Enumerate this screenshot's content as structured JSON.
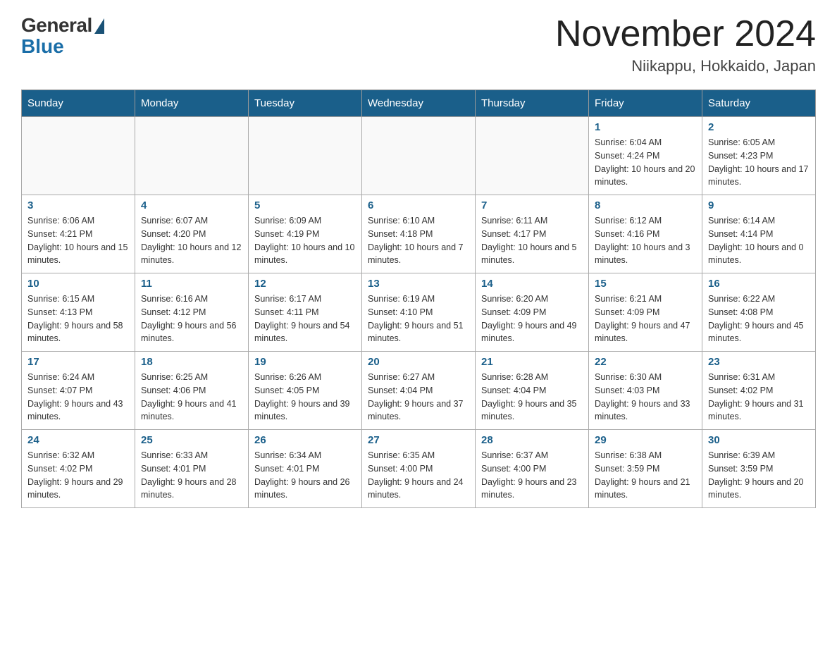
{
  "header": {
    "logo": {
      "general": "General",
      "blue": "Blue"
    },
    "title": "November 2024",
    "subtitle": "Niikappu, Hokkaido, Japan"
  },
  "weekdays": [
    "Sunday",
    "Monday",
    "Tuesday",
    "Wednesday",
    "Thursday",
    "Friday",
    "Saturday"
  ],
  "weeks": [
    [
      {
        "day": null
      },
      {
        "day": null
      },
      {
        "day": null
      },
      {
        "day": null
      },
      {
        "day": null
      },
      {
        "day": 1,
        "sunrise": "6:04 AM",
        "sunset": "4:24 PM",
        "daylight": "10 hours and 20 minutes."
      },
      {
        "day": 2,
        "sunrise": "6:05 AM",
        "sunset": "4:23 PM",
        "daylight": "10 hours and 17 minutes."
      }
    ],
    [
      {
        "day": 3,
        "sunrise": "6:06 AM",
        "sunset": "4:21 PM",
        "daylight": "10 hours and 15 minutes."
      },
      {
        "day": 4,
        "sunrise": "6:07 AM",
        "sunset": "4:20 PM",
        "daylight": "10 hours and 12 minutes."
      },
      {
        "day": 5,
        "sunrise": "6:09 AM",
        "sunset": "4:19 PM",
        "daylight": "10 hours and 10 minutes."
      },
      {
        "day": 6,
        "sunrise": "6:10 AM",
        "sunset": "4:18 PM",
        "daylight": "10 hours and 7 minutes."
      },
      {
        "day": 7,
        "sunrise": "6:11 AM",
        "sunset": "4:17 PM",
        "daylight": "10 hours and 5 minutes."
      },
      {
        "day": 8,
        "sunrise": "6:12 AM",
        "sunset": "4:16 PM",
        "daylight": "10 hours and 3 minutes."
      },
      {
        "day": 9,
        "sunrise": "6:14 AM",
        "sunset": "4:14 PM",
        "daylight": "10 hours and 0 minutes."
      }
    ],
    [
      {
        "day": 10,
        "sunrise": "6:15 AM",
        "sunset": "4:13 PM",
        "daylight": "9 hours and 58 minutes."
      },
      {
        "day": 11,
        "sunrise": "6:16 AM",
        "sunset": "4:12 PM",
        "daylight": "9 hours and 56 minutes."
      },
      {
        "day": 12,
        "sunrise": "6:17 AM",
        "sunset": "4:11 PM",
        "daylight": "9 hours and 54 minutes."
      },
      {
        "day": 13,
        "sunrise": "6:19 AM",
        "sunset": "4:10 PM",
        "daylight": "9 hours and 51 minutes."
      },
      {
        "day": 14,
        "sunrise": "6:20 AM",
        "sunset": "4:09 PM",
        "daylight": "9 hours and 49 minutes."
      },
      {
        "day": 15,
        "sunrise": "6:21 AM",
        "sunset": "4:09 PM",
        "daylight": "9 hours and 47 minutes."
      },
      {
        "day": 16,
        "sunrise": "6:22 AM",
        "sunset": "4:08 PM",
        "daylight": "9 hours and 45 minutes."
      }
    ],
    [
      {
        "day": 17,
        "sunrise": "6:24 AM",
        "sunset": "4:07 PM",
        "daylight": "9 hours and 43 minutes."
      },
      {
        "day": 18,
        "sunrise": "6:25 AM",
        "sunset": "4:06 PM",
        "daylight": "9 hours and 41 minutes."
      },
      {
        "day": 19,
        "sunrise": "6:26 AM",
        "sunset": "4:05 PM",
        "daylight": "9 hours and 39 minutes."
      },
      {
        "day": 20,
        "sunrise": "6:27 AM",
        "sunset": "4:04 PM",
        "daylight": "9 hours and 37 minutes."
      },
      {
        "day": 21,
        "sunrise": "6:28 AM",
        "sunset": "4:04 PM",
        "daylight": "9 hours and 35 minutes."
      },
      {
        "day": 22,
        "sunrise": "6:30 AM",
        "sunset": "4:03 PM",
        "daylight": "9 hours and 33 minutes."
      },
      {
        "day": 23,
        "sunrise": "6:31 AM",
        "sunset": "4:02 PM",
        "daylight": "9 hours and 31 minutes."
      }
    ],
    [
      {
        "day": 24,
        "sunrise": "6:32 AM",
        "sunset": "4:02 PM",
        "daylight": "9 hours and 29 minutes."
      },
      {
        "day": 25,
        "sunrise": "6:33 AM",
        "sunset": "4:01 PM",
        "daylight": "9 hours and 28 minutes."
      },
      {
        "day": 26,
        "sunrise": "6:34 AM",
        "sunset": "4:01 PM",
        "daylight": "9 hours and 26 minutes."
      },
      {
        "day": 27,
        "sunrise": "6:35 AM",
        "sunset": "4:00 PM",
        "daylight": "9 hours and 24 minutes."
      },
      {
        "day": 28,
        "sunrise": "6:37 AM",
        "sunset": "4:00 PM",
        "daylight": "9 hours and 23 minutes."
      },
      {
        "day": 29,
        "sunrise": "6:38 AM",
        "sunset": "3:59 PM",
        "daylight": "9 hours and 21 minutes."
      },
      {
        "day": 30,
        "sunrise": "6:39 AM",
        "sunset": "3:59 PM",
        "daylight": "9 hours and 20 minutes."
      }
    ]
  ]
}
